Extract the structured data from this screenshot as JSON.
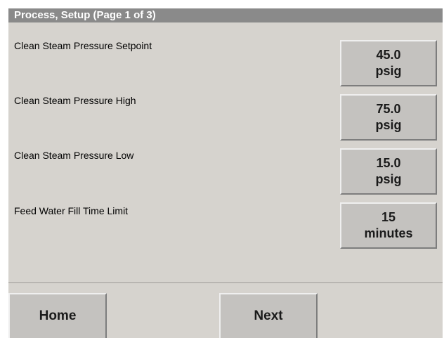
{
  "title": "Process, Setup (Page 1 of 3)",
  "parameters": [
    {
      "label": "Clean Steam Pressure Setpoint",
      "value": "45.0",
      "unit": "psig"
    },
    {
      "label": "Clean Steam Pressure High",
      "value": "75.0",
      "unit": "psig"
    },
    {
      "label": "Clean Steam Pressure Low",
      "value": "15.0",
      "unit": "psig"
    },
    {
      "label": "Feed Water Fill Time Limit",
      "value": "15",
      "unit": "minutes"
    }
  ],
  "nav": {
    "home_label": "Home",
    "next_label": "Next"
  },
  "colors": {
    "panel_background": "#d6d3ce",
    "title_bar": "#8a8a8a",
    "title_text": "#ffffff",
    "button_face": "#c4c2bf"
  }
}
